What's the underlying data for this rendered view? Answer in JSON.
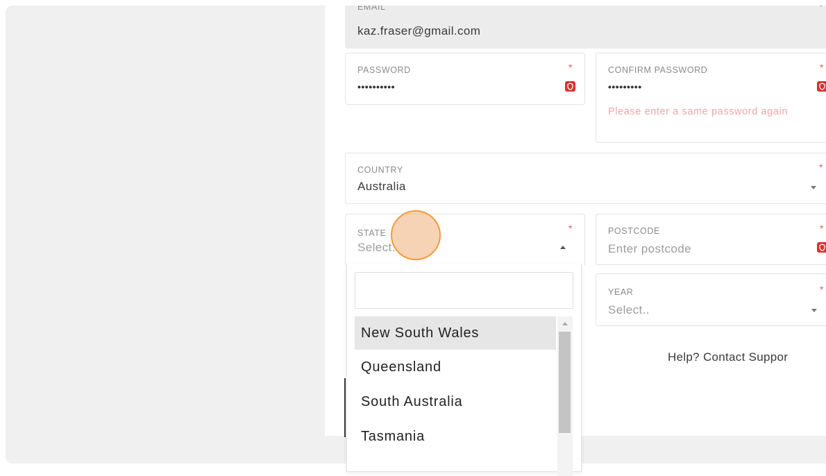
{
  "form": {
    "email": {
      "label": "EMAIL",
      "value": "kaz.fraser@gmail.com"
    },
    "password": {
      "label": "PASSWORD",
      "value": "••••••••••",
      "required_mark": "*"
    },
    "confirm_password": {
      "label": "CONFIRM PASSWORD",
      "value": "•••••••••",
      "required_mark": "*",
      "error": "Please enter a same password again"
    },
    "country": {
      "label": "COUNTRY",
      "value": "Australia",
      "required_mark": "*"
    },
    "state": {
      "label": "STATE",
      "placeholder": "Select..",
      "required_mark": "*"
    },
    "postcode": {
      "label": "POSTCODE",
      "placeholder": "Enter postcode",
      "required_mark": "*"
    },
    "year": {
      "label": "YEAR",
      "placeholder": "Select..",
      "required_mark": "*"
    },
    "email_required_mark": "*"
  },
  "state_dropdown": {
    "search_value": "",
    "options": [
      "New South Wales",
      "Queensland",
      "South Australia",
      "Tasmania"
    ],
    "highlighted": "New South Wales"
  },
  "help": {
    "text": "Help? Contact Suppor"
  },
  "icons": {
    "password_manager": "keeper-lock-icon",
    "caret": "chevron-down-icon"
  },
  "colors": {
    "required": "#e05a5a",
    "error_text": "#f0a5a5",
    "password_manager_icon": "#d9302f",
    "cursor_highlight": "#f39a3b"
  }
}
